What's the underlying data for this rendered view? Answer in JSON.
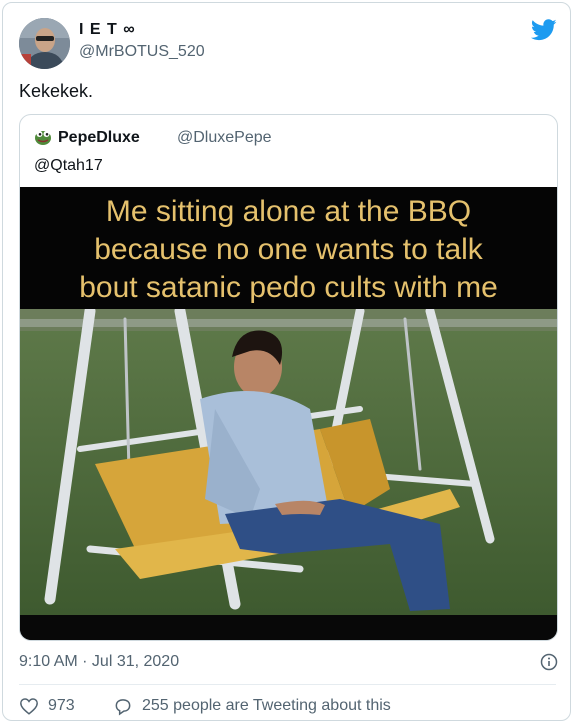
{
  "tweet": {
    "author": {
      "display_name": "I E T ∞",
      "handle": "@MrBOTUS_520",
      "avatar_icon": "avatar-photo"
    },
    "text": "Kekekek.",
    "timestamp": "9:10 AM · Jul 31, 2020",
    "likes": "973",
    "conversation": "255 people are Tweeting about this"
  },
  "quote": {
    "display_name": "PepeDluxe",
    "handle": "@DluxePepe",
    "icon": "pepe-frog-icon",
    "reply_to": "@Qtah17",
    "meme_caption": "Me sitting alone at the BBQ\nbecause no one wants to talk\nbout satanic pedo cults with me"
  },
  "colors": {
    "twitter_blue": "#1d9bf0",
    "caption_gold": "#e5c16d",
    "secondary_text": "#536471",
    "border": "#cfd9de"
  }
}
